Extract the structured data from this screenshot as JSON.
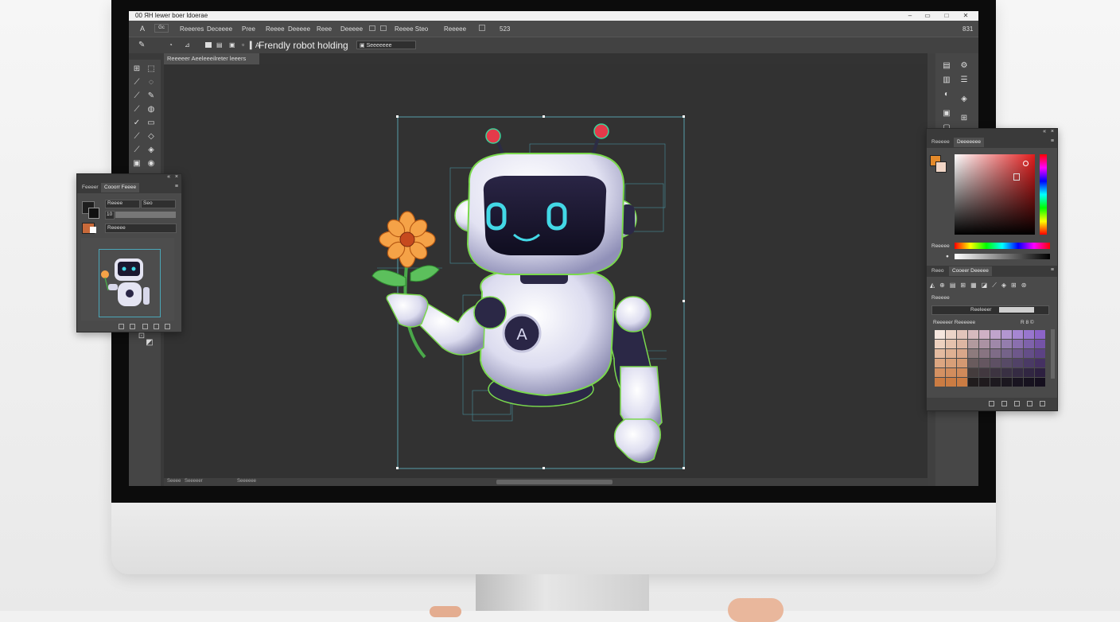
{
  "title_bar": {
    "text": "00 ЯН lewer boer ldoerae"
  },
  "menu": {
    "items": [
      "Reeeres",
      "Deceeee",
      "Pree",
      "Reeee",
      "Deeeee",
      "Reee",
      "Deeeee"
    ],
    "extras": [
      "Reeee Steo",
      "Reeeee",
      "523"
    ],
    "right_value": "831"
  },
  "options_bar": {
    "document_name": "Frendly robot holding",
    "field_value": "Seeeeeee"
  },
  "document_tab": {
    "label": "Reeeeer Aeeleeeilreter leeers"
  },
  "status_bar": {
    "items": [
      "Seeee",
      "Seeeeer",
      "Seeeeee"
    ]
  },
  "layers_panel": {
    "tabs": [
      "Feeeer",
      "Cooorr Feeee"
    ],
    "rows": [
      {
        "name": "Reeee",
        "value": "Seo"
      },
      {
        "name": "10",
        "value": ""
      },
      {
        "name": "Reeeee",
        "value": ""
      }
    ]
  },
  "color_panel": {
    "tabs": [
      "Reeeee",
      "Deeeeeee"
    ],
    "hue_label": "Reeeee",
    "foreground_color": "#e58a2a",
    "background_color": "#f1d6c6"
  },
  "swatches_panel": {
    "tabs": [
      "Reeo",
      "Cooeer Deeeee"
    ],
    "label": "Reeeee",
    "field_label": "Reeleeer",
    "swatch_title": "Reeeeer Reeeeee",
    "swatch_title_right": "R 8 ©"
  }
}
